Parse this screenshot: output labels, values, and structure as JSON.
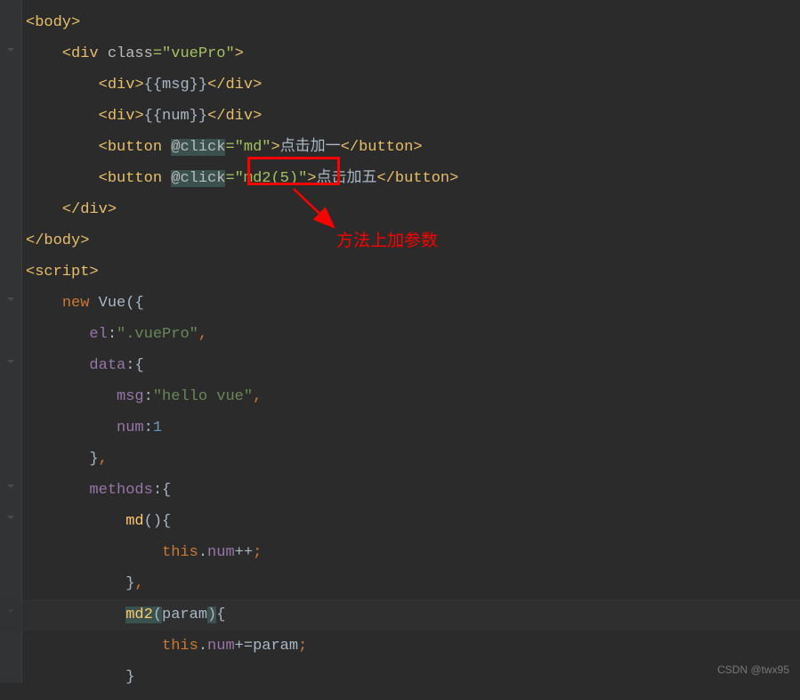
{
  "code": {
    "l1": {
      "tag_open": "<body>",
      "tag_close": ""
    },
    "l2": {
      "indent": "    ",
      "open": "<",
      "tag": "div",
      "sp": " ",
      "attr": "class",
      "eq": "=",
      "val": "\"vuePro\"",
      "close": ">"
    },
    "l3": {
      "indent": "        ",
      "open": "<",
      "tag": "div",
      "close": ">",
      "m_open": "{{",
      "var": "msg",
      "m_close": "}}",
      "c_open": "</",
      "c_tag": "div",
      "c_close": ">"
    },
    "l4": {
      "indent": "        ",
      "open": "<",
      "tag": "div",
      "close": ">",
      "m_open": "{{",
      "var": "num",
      "m_close": "}}",
      "c_open": "</",
      "c_tag": "div",
      "c_close": ">"
    },
    "l5": {
      "indent": "        ",
      "open": "<",
      "tag": "button",
      "sp": " ",
      "attr": "@click",
      "eq": "=",
      "val": "\"md\"",
      "close": ">",
      "text": "点击加一",
      "c_open": "</",
      "c_tag": "button",
      "c_close": ">"
    },
    "l6": {
      "indent": "        ",
      "open": "<",
      "tag": "button",
      "sp": " ",
      "attr": "@click",
      "eq": "=",
      "val": "\"md2(5)\"",
      "close": ">",
      "text": "点击加五",
      "c_open": "</",
      "c_tag": "button",
      "c_close": ">"
    },
    "l7": {
      "indent": "    ",
      "c_open": "</",
      "c_tag": "div",
      "c_close": ">"
    },
    "l8": {
      "c_open": "</",
      "c_tag": "body",
      "c_close": ">"
    },
    "l9": {
      "open": "<",
      "tag": "script",
      "close": ">"
    },
    "l10": {
      "indent": "    ",
      "kw": "new ",
      "cls": "Vue",
      "paren_o": "(",
      "brace": "{"
    },
    "l11": {
      "indent": "       ",
      "prop": "el",
      "colon": ":",
      "val": "\".vuePro\"",
      "comma": ","
    },
    "l12": {
      "indent": "       ",
      "prop": "data",
      "colon": ":",
      "brace": "{"
    },
    "l13": {
      "indent": "          ",
      "prop": "msg",
      "colon": ":",
      "val": "\"hello vue\"",
      "comma": ","
    },
    "l14": {
      "indent": "          ",
      "prop": "num",
      "colon": ":",
      "val": "1"
    },
    "l15": {
      "indent": "       ",
      "brace": "}",
      "comma": ","
    },
    "l16": {
      "indent": "       ",
      "prop": "methods",
      "colon": ":",
      "brace": "{"
    },
    "l17": {
      "indent": "           ",
      "method": "md",
      "paren": "()",
      "brace": "{"
    },
    "l18": {
      "indent": "               ",
      "this": "this",
      "dot": ".",
      "prop": "num",
      "op": "++",
      ";": ";"
    },
    "l19": {
      "indent": "           ",
      "brace": "}",
      "comma": ","
    },
    "l20": {
      "indent": "           ",
      "method": "md2",
      "paren_o": "(",
      "param": "param",
      "paren_c": ")",
      "brace": "{"
    },
    "l21": {
      "indent": "               ",
      "this": "this",
      "dot": ".",
      "prop": "num",
      "op": "+=",
      "param": "param",
      ";": ";"
    },
    "l22": {
      "indent": "           ",
      "brace": "}"
    }
  },
  "annotation": {
    "text": "方法上加参数"
  },
  "watermark": "CSDN @twx95"
}
